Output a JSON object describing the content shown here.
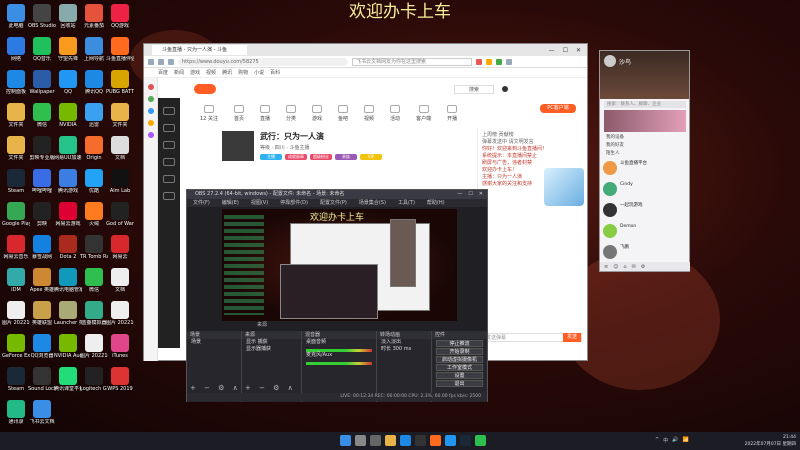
{
  "desktop": {
    "banner": "欢迎办卡上车",
    "icons": [
      {
        "label": "此电脑",
        "color": "#3a8ee6"
      },
      {
        "label": "OBS Studio",
        "color": "#444"
      },
      {
        "label": "回收站",
        "color": "#8aa"
      },
      {
        "label": "元素番茄",
        "color": "#e5533d"
      },
      {
        "label": "QQ游戏",
        "color": "#e24"
      },
      {
        "label": "网络",
        "color": "#2c7be5"
      },
      {
        "label": "QQ音乐",
        "color": "#1ec15b"
      },
      {
        "label": "守望先锋",
        "color": "#f79a1e"
      },
      {
        "label": "上网导航",
        "color": "#3b8de0"
      },
      {
        "label": "斗鱼直播伴侣",
        "color": "#ff6a1e"
      },
      {
        "label": "控制面板",
        "color": "#1e88e5"
      },
      {
        "label": "Wallpaper",
        "color": "#2b5ca8"
      },
      {
        "label": "QQ",
        "color": "#2196f3"
      },
      {
        "label": "腾讯QQ",
        "color": "#1e88e5"
      },
      {
        "label": "PUBG BATTLEGR.",
        "color": "#d9a400"
      },
      {
        "label": "文件夹",
        "color": "#e8b44a"
      },
      {
        "label": "微信",
        "color": "#2fbf4f"
      },
      {
        "label": "NVIDIA",
        "color": "#76b900"
      },
      {
        "label": "迅雷",
        "color": "#3aa0f0"
      },
      {
        "label": "文件夹",
        "color": "#e8b44a"
      },
      {
        "label": "文件夹",
        "color": "#e8b44a"
      },
      {
        "label": "剪映专业版",
        "color": "#222"
      },
      {
        "label": "网易UU加速器",
        "color": "#25c28a"
      },
      {
        "label": "Origin",
        "color": "#f56c2d"
      },
      {
        "label": "文档",
        "color": "#ddd"
      },
      {
        "label": "Steam",
        "color": "#1b2838"
      },
      {
        "label": "哔哩哔哩",
        "color": "#3a6ce6"
      },
      {
        "label": "腾讯游戏",
        "color": "#3b7de0"
      },
      {
        "label": "优酷",
        "color": "#23a3f5"
      },
      {
        "label": "Aim Lab",
        "color": "#111"
      },
      {
        "label": "Google Play",
        "color": "#34a853"
      },
      {
        "label": "剪映",
        "color": "#222"
      },
      {
        "label": "网易云游戏",
        "color": "#d03"
      },
      {
        "label": "火绒",
        "color": "#ff7b1e"
      },
      {
        "label": "God of War",
        "color": "#222"
      },
      {
        "label": "网易云音乐",
        "color": "#d8272d"
      },
      {
        "label": "暴雪战网",
        "color": "#1480e0"
      },
      {
        "label": "Dota 2",
        "color": "#aa2a1e"
      },
      {
        "label": "TR Tomb Raider",
        "color": "#333"
      },
      {
        "label": "网易云",
        "color": "#d8272d"
      },
      {
        "label": "IDM",
        "color": "#3aa"
      },
      {
        "label": "Apex 英雄",
        "color": "#c83"
      },
      {
        "label": "腾讯电脑管家",
        "color": "#19b"
      },
      {
        "label": "微信",
        "color": "#2fbf4f"
      },
      {
        "label": "文档",
        "color": "#eee"
      },
      {
        "label": "图片 20221010",
        "color": "#eee"
      },
      {
        "label": "英雄联盟",
        "color": "#c9a04a"
      },
      {
        "label": "Launcher 英雄联盟",
        "color": "#aa7"
      },
      {
        "label": "蓝叠模拟器",
        "color": "#3a8"
      },
      {
        "label": "图片 20221021",
        "color": "#eee"
      },
      {
        "label": "GeForce Experience",
        "color": "#76b900"
      },
      {
        "label": "QQ浏览器",
        "color": "#1e88e5"
      },
      {
        "label": "NVIDIA Audio",
        "color": "#76b900"
      },
      {
        "label": "图片 20221016",
        "color": "#eee"
      },
      {
        "label": "iTunes",
        "color": "#e0458a"
      },
      {
        "label": "Steam",
        "color": "#1b2838"
      },
      {
        "label": "Sound Lock",
        "color": "#333"
      },
      {
        "label": "腾讯课堂平台",
        "color": "#2d7"
      },
      {
        "label": "Logitech G HUB",
        "color": "#222"
      },
      {
        "label": "WPS 2019",
        "color": "#d33"
      },
      {
        "label": "通讯录",
        "color": "#2b8"
      },
      {
        "label": "飞书云文档",
        "color": "#3a8ee6"
      }
    ]
  },
  "browser": {
    "tab_title": "斗鱼直播 - 只为一人演 - 斗鱼",
    "window_controls": [
      "—",
      "☐",
      "✕"
    ],
    "url": "https://www.douyu.com/58275",
    "search_placeholder": "飞书云文档网友为你在这里搜索",
    "bookmarks": [
      "百度",
      "新闻",
      "游戏",
      "视频",
      "腾讯",
      "购物",
      "小说",
      "百科"
    ],
    "site_search": "搜索",
    "nav": [
      "12 关注",
      "首页",
      "直播",
      "分类",
      "游戏",
      "鱼吧",
      "视频",
      "活动",
      "客户端",
      "开播"
    ],
    "pc_button": "PC客户端",
    "streamer_title": "武行：只为一人演",
    "streamer_sub": "等级 · 四川 · 斗鱼主播",
    "tags": [
      {
        "text": "主播",
        "color": "#2fb2f0"
      },
      {
        "text": "成就勋章",
        "color": "#e84a6a"
      },
      {
        "text": "超级粉丝",
        "color": "#e84a6a"
      },
      {
        "text": "贵族",
        "color": "#9b59b6"
      },
      {
        "text": "VIP",
        "color": "#f1c40f"
      }
    ],
    "chat_lines": [
      {
        "text": "上周榜 贡献榜",
        "gray": true
      },
      {
        "text": "弹幕发送中 请文明发言",
        "gray": true
      },
      {
        "text": "你好！欢迎来到斗鱼直播间！",
        "gray": false
      },
      {
        "text": "系统提示：本直播间禁止",
        "gray": false
      },
      {
        "text": "刷屏与广告，违者封禁",
        "gray": false
      },
      {
        "text": "欢迎办卡上车！",
        "gray": false
      },
      {
        "text": "主播：只为一人演",
        "gray": false
      },
      {
        "text": "感谢大家的关注和支持",
        "gray": false
      }
    ],
    "chat_placeholder": "发送弹幕",
    "send_label": "发送"
  },
  "obs": {
    "title": "OBS 27.2.4 (64-bit, windows) - 配置文件: 未命名 - 场景: 未命名",
    "menu": [
      "文件(F)",
      "编辑(E)",
      "视图(V)",
      "停靠部件(D)",
      "配置文件(P)",
      "场景集合(S)",
      "工具(T)",
      "帮助(H)"
    ],
    "window_controls": [
      "—",
      "☐",
      "✕"
    ],
    "preview_banner": "欢迎办卡上车",
    "scene_tab_label": "来源",
    "panels": {
      "scenes": {
        "header": "场景",
        "rows": [
          "场景"
        ]
      },
      "sources": {
        "header": "来源",
        "rows": [
          "显示 捕获",
          "显示器捕获"
        ]
      },
      "mixer": {
        "header": "混音器",
        "rows": [
          "桌面音频",
          "麦克风/Aux"
        ]
      },
      "transitions": {
        "header": "转场动画",
        "rows": [
          "淡入淡出",
          "时长 300 ms"
        ]
      },
      "controls": {
        "header": "控件",
        "buttons": [
          "停止推流",
          "开始录制",
          "启动虚拟摄像机",
          "工作室模式",
          "设置",
          "退出"
        ]
      }
    },
    "panel_foot": "+ − ⚙ ∧ ∨",
    "status": "LIVE: 00:12:34  REC: 00:00:00  CPU: 2.3%, 60.00 fps  kb/s: 2500"
  },
  "qq": {
    "name": "沙鸟",
    "search_placeholder": "搜索：联系人、群聊、企业",
    "groups": [
      "我的设备",
      "我的好友",
      "陌生人"
    ],
    "contacts": [
      {
        "name": "斗鱼直播平台",
        "color": "#e94"
      },
      {
        "name": "Cindy",
        "color": "#4a7"
      },
      {
        "name": "一起玩游戏",
        "color": "#333"
      },
      {
        "name": "Demon",
        "color": "#8c4"
      },
      {
        "name": "飞鹏",
        "color": "#777"
      }
    ],
    "bottom_icons": [
      "≡",
      "☺",
      "⌂",
      "✉",
      "⚙"
    ]
  },
  "taskbar": {
    "tray_time": "21:44",
    "tray_date": "2022年07月07日 星期四",
    "sys": [
      "^",
      "中",
      "🔊",
      "📶"
    ],
    "apps": [
      {
        "name": "开始",
        "color": "#3a8ee6"
      },
      {
        "name": "搜索",
        "color": "#888"
      },
      {
        "name": "任务视图",
        "color": "#666"
      },
      {
        "name": "文件管理器",
        "color": "#e8b44a"
      },
      {
        "name": "QQ浏览器",
        "color": "#1e88e5"
      },
      {
        "name": "OBS",
        "color": "#333"
      },
      {
        "name": "斗鱼",
        "color": "#ff6a1e"
      },
      {
        "name": "QQ",
        "color": "#2196f3"
      },
      {
        "name": "Steam",
        "color": "#1b2838"
      },
      {
        "name": "微信",
        "color": "#2fbf4f"
      }
    ]
  }
}
